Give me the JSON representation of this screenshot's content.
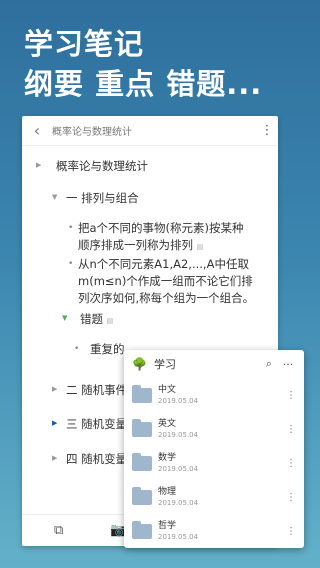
{
  "hero": {
    "line1": "学习笔记",
    "line2": "纲要 重点 错题..."
  },
  "topbar": {
    "back_icon": "‹",
    "title": "概率论与数理统计",
    "more_icon": "⋮"
  },
  "outline": {
    "root": "概率论与数理统计",
    "sec1": "一 排列与组合",
    "b1": "把a个不同的事物(称元素)按某种顺序排成一列称为排列",
    "b2": "从n个不同元素A1,A2,...,A中任取m(m≤n)个作成一组而不论它们排列次序如何,称每个组为一个组合。",
    "wrong": "错题",
    "b3": "重复的",
    "sec2": "二 随机事件",
    "sec3": "三 随机变量",
    "sec4": "四 随机变量"
  },
  "bottombar": {
    "left_icon": "⧉",
    "camera_icon": "📷"
  },
  "popup": {
    "title": "学习",
    "search_icon": "⌕",
    "more_icon": "···",
    "folders": [
      {
        "name": "中文",
        "date": "2019.05.04"
      },
      {
        "name": "英文",
        "date": "2019.05.04"
      },
      {
        "name": "数学",
        "date": "2019.05.04"
      },
      {
        "name": "物理",
        "date": "2019.05.04"
      },
      {
        "name": "哲学",
        "date": "2019.05.04"
      }
    ]
  }
}
